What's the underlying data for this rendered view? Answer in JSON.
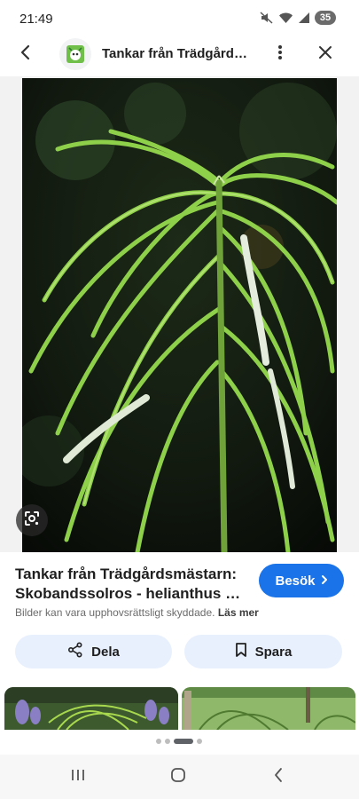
{
  "status_bar": {
    "time": "21:49",
    "battery": "35",
    "icons": [
      "mute-icon",
      "wifi-icon",
      "signal-icon",
      "battery-icon"
    ]
  },
  "topbar": {
    "title": "Tankar från Trädgårdsmästarn",
    "icons": [
      "back-arrow-icon",
      "site-logo-icon",
      "more-vert-icon",
      "close-icon"
    ]
  },
  "image": {
    "icons": [
      "google-lens-icon"
    ]
  },
  "result": {
    "title_line1": "Tankar från Trädgårdsmästarn:",
    "title_line2": "Skobandssolros - helianthus salicifolius",
    "visit_label": "Besök",
    "copyright_text": "Bilder kan vara upphovsrättsligt skyddade.",
    "learn_more": "Läs mer"
  },
  "actions": {
    "share_label": "Dela",
    "save_label": "Spara"
  },
  "pager": {
    "count": 4,
    "active_index": 2
  },
  "colors": {
    "accent": "#1a73e8",
    "button_bg": "#e8f0fe",
    "plant_green": "#7cc33a"
  },
  "navbar": {
    "icons": [
      "recent-apps-icon",
      "home-icon",
      "back-icon"
    ]
  }
}
